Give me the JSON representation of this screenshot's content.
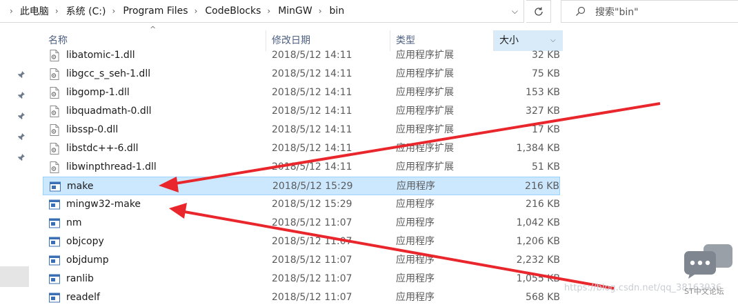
{
  "address_bar": {
    "breadcrumbs": [
      "此电脑",
      "系统 (C:)",
      "Program Files",
      "CodeBlocks",
      "MinGW",
      "bin"
    ]
  },
  "search": {
    "placeholder": "搜索\"bin\""
  },
  "columns": {
    "name": "名称",
    "date": "修改日期",
    "type": "类型",
    "size": "大小",
    "sorted_column": "size"
  },
  "files": [
    {
      "name": "libatomic-1.dll",
      "date": "2018/5/12 14:11",
      "type": "应用程序扩展",
      "size": "32 KB",
      "icon": "dll-file-icon",
      "selected": false
    },
    {
      "name": "libgcc_s_seh-1.dll",
      "date": "2018/5/12 14:11",
      "type": "应用程序扩展",
      "size": "75 KB",
      "icon": "dll-file-icon",
      "selected": false
    },
    {
      "name": "libgomp-1.dll",
      "date": "2018/5/12 14:11",
      "type": "应用程序扩展",
      "size": "153 KB",
      "icon": "dll-file-icon",
      "selected": false
    },
    {
      "name": "libquadmath-0.dll",
      "date": "2018/5/12 14:11",
      "type": "应用程序扩展",
      "size": "327 KB",
      "icon": "dll-file-icon",
      "selected": false
    },
    {
      "name": "libssp-0.dll",
      "date": "2018/5/12 14:11",
      "type": "应用程序扩展",
      "size": "17 KB",
      "icon": "dll-file-icon",
      "selected": false
    },
    {
      "name": "libstdc++-6.dll",
      "date": "2018/5/12 14:11",
      "type": "应用程序扩展",
      "size": "1,384 KB",
      "icon": "dll-file-icon",
      "selected": false
    },
    {
      "name": "libwinpthread-1.dll",
      "date": "2018/5/12 14:11",
      "type": "应用程序扩展",
      "size": "51 KB",
      "icon": "dll-file-icon",
      "selected": false
    },
    {
      "name": "make",
      "date": "2018/5/12 15:29",
      "type": "应用程序",
      "size": "216 KB",
      "icon": "exe-file-icon",
      "selected": true
    },
    {
      "name": "mingw32-make",
      "date": "2018/5/12 15:29",
      "type": "应用程序",
      "size": "216 KB",
      "icon": "exe-file-icon",
      "selected": false
    },
    {
      "name": "nm",
      "date": "2018/5/12 11:07",
      "type": "应用程序",
      "size": "1,042 KB",
      "icon": "exe-file-icon",
      "selected": false
    },
    {
      "name": "objcopy",
      "date": "2018/5/12 11:07",
      "type": "应用程序",
      "size": "1,206 KB",
      "icon": "exe-file-icon",
      "selected": false
    },
    {
      "name": "objdump",
      "date": "2018/5/12 11:07",
      "type": "应用程序",
      "size": "2,232 KB",
      "icon": "exe-file-icon",
      "selected": false
    },
    {
      "name": "ranlib",
      "date": "2018/5/12 11:07",
      "type": "应用程序",
      "size": "1,055 KB",
      "icon": "exe-file-icon",
      "selected": false
    },
    {
      "name": "readelf",
      "date": "2018/5/12 11:07",
      "type": "应用程序",
      "size": "568 KB",
      "icon": "exe-file-icon",
      "selected": false
    }
  ],
  "watermark": "https://blog.csdn.net/qq_38163936",
  "badge_text": "ST中文论坛",
  "colors": {
    "selection_bg": "#cce8ff",
    "selection_border": "#99d1ff",
    "arrow": "#e8262b",
    "header_text": "#4d6082"
  }
}
